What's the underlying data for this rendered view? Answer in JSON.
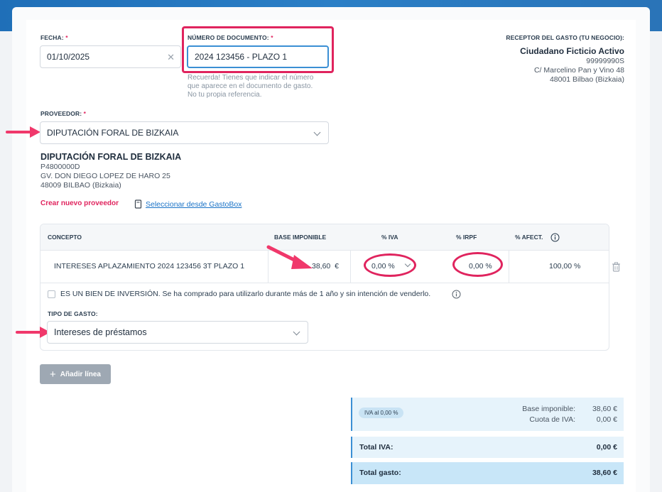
{
  "form": {
    "fecha_label": "FECHA:",
    "fecha_value": "01/10/2025",
    "numero_label": "NÚMERO DE DOCUMENTO:",
    "numero_value": "2024 123456 - PLAZO 1",
    "numero_hint_1": "Recuerda! Tienes que indicar el número",
    "numero_hint_2": "que aparece en el documento de gasto.",
    "numero_hint_3": "No tu propia referencia.",
    "required_mark": "*"
  },
  "receptor": {
    "label": "RECEPTOR DEL GASTO (TU NEGOCIO):",
    "name": "Ciudadano Ficticio Activo",
    "nif": "99999990S",
    "address": "C/ Marcelino Pan y Vino 48",
    "city": "48001 Bilbao (Bizkaia)"
  },
  "proveedor": {
    "label": "PROVEEDOR:",
    "selected": "DIPUTACIÓN FORAL DE BIZKAIA",
    "name": "DIPUTACIÓN FORAL DE BIZKAIA",
    "nif": "P4800000D",
    "address": "GV. DON DIEGO LOPEZ DE HARO 25",
    "city": "48009 BILBAO (Bizkaia)",
    "create_link": "Crear nuevo proveedor",
    "gastobox_link": "Seleccionar desde GastoBox"
  },
  "table": {
    "headers": {
      "concepto": "CONCEPTO",
      "base": "BASE IMPONIBLE",
      "iva": "% IVA",
      "irpf": "% IRPF",
      "afect": "% AFECT."
    },
    "row": {
      "concepto": "INTERESES APLAZAMIENTO 2024 123456 3T PLAZO 1",
      "base": "38,60",
      "currency": "€",
      "iva": "0,00 %",
      "irpf": "0,00 %",
      "afect": "100,00 %"
    },
    "inversion_text": "ES UN BIEN DE INVERSIÓN. Se ha comprado para utilizarlo durante más de 1 año y sin intención de venderlo.",
    "tipo_label": "TIPO DE GASTO:",
    "tipo_value": "Intereses de préstamos"
  },
  "actions": {
    "add_line": "Añadir línea"
  },
  "summary": {
    "iva_badge": "IVA al 0,00 %",
    "base_label": "Base imponible:",
    "base_value": "38,60 €",
    "cuota_label": "Cuota de IVA:",
    "cuota_value": "0,00 €",
    "total_iva_label": "Total IVA:",
    "total_iva_value": "0,00 €",
    "total_gasto_label": "Total gasto:",
    "total_gasto_value": "38,60 €"
  },
  "colors": {
    "accent_pink": "#e0245e",
    "link_blue": "#1a73c7",
    "summary_bg": "#e6f3fb",
    "header_blue": "#2b7fc6"
  }
}
